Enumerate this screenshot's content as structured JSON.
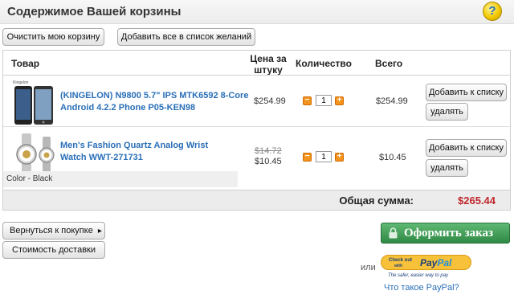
{
  "header": {
    "title": "Содержимое Вашей корзины",
    "help_icon": "question-icon",
    "help_glyph": "?"
  },
  "toolbar": {
    "clear_cart_label": "Очистить мою корзину",
    "add_wishlist_label": "Добавить все в список желаний"
  },
  "table": {
    "columns": {
      "product": "Товар",
      "unit_price_line1": "Цена за",
      "unit_price_line2": "штуку",
      "quantity": "Количество",
      "total": "Всего"
    },
    "rows": [
      {
        "image_icon": "phone-product-image",
        "image_label": "Kingelon",
        "name_line1": "(KINGELON) N9800 5.7\" IPS MTK6592 8-Core",
        "name_line2": "Android 4.2.2 Phone P05-KEN98",
        "price": "$254.99",
        "old_price": "",
        "quantity": "1",
        "total": "$254.99",
        "wishlist_label": "Добавить к списку",
        "remove_label": "удалять"
      },
      {
        "image_icon": "watch-product-image",
        "name_line1": "Men's Fashion Quartz Analog Wrist",
        "name_line2": "Watch WWT-271731",
        "price": "$10.45",
        "old_price": "$14.72",
        "quantity": "1",
        "total": "$10.45",
        "variant": "Color - Black",
        "wishlist_label": "Добавить к списку",
        "remove_label": "удалять"
      }
    ],
    "grand_total_label": "Общая сумма:",
    "grand_total_value": "$265.44"
  },
  "bottom": {
    "continue_label": "Вернуться к покупке",
    "continue_arrow": "▸",
    "shipping_label": "Стоимость доставки",
    "checkout_label": "Оформить заказ",
    "or_label": "или",
    "paypal": {
      "line1": "Check out",
      "line2": "with",
      "brand_pay": "Pay",
      "brand_pal": "Pal",
      "tagline": "The safer, easier way to pay"
    },
    "paypal_link": "Что такое PayPal?"
  },
  "colors": {
    "link": "#2a6fb8",
    "total": "#c0272d",
    "checkout": "#2f8a45",
    "qty_button": "#f2941e"
  }
}
